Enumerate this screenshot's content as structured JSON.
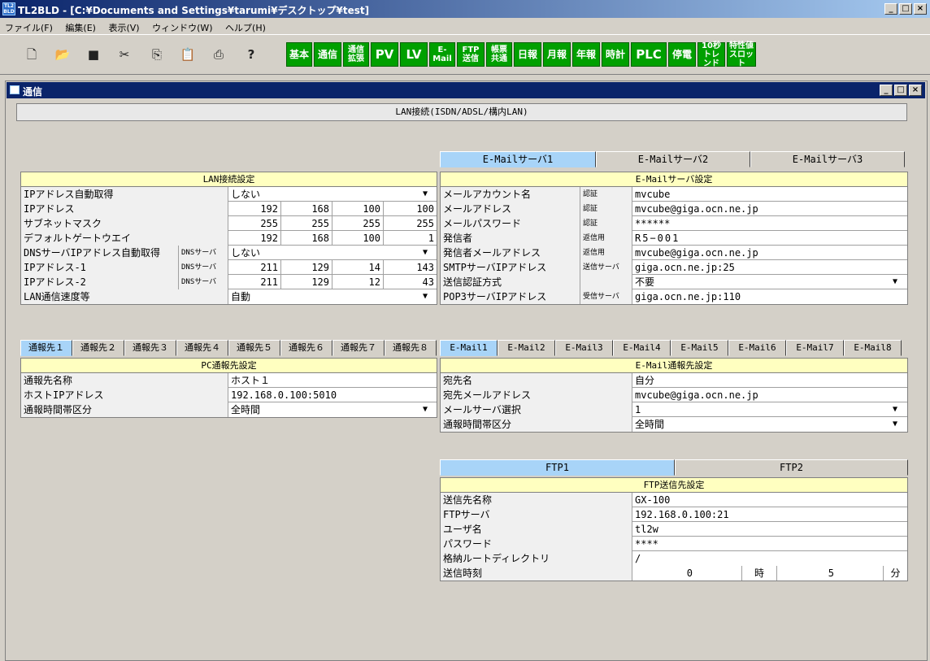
{
  "window": {
    "title": "TL2BLD - [C:¥Documents and Settings¥tarumi¥デスクトップ¥test]",
    "app_icon_text": "TL2 BLD",
    "min": "_",
    "max": "□",
    "close": "×"
  },
  "menu": [
    "ファイル(F)",
    "編集(E)",
    "表示(V)",
    "ウィンドウ(W)",
    "ヘルプ(H)"
  ],
  "toolbar": {
    "icons": [
      {
        "name": "new-file-icon",
        "glyph": "🗋"
      },
      {
        "name": "open-folder-icon",
        "glyph": "📂"
      },
      {
        "name": "save-icon",
        "glyph": "■"
      },
      {
        "name": "cut-icon",
        "glyph": "✂"
      },
      {
        "name": "copy-icon",
        "glyph": "⎘"
      },
      {
        "name": "paste-icon",
        "glyph": "📋"
      },
      {
        "name": "print-icon",
        "glyph": "⎙"
      },
      {
        "name": "help-icon",
        "glyph": "?"
      }
    ],
    "buttons": [
      "基本",
      "通信",
      "通信 拡張",
      "PV",
      "LV",
      "E- Mail",
      "FTP 送信",
      "帳票 共通",
      "日報",
      "月報",
      "年報",
      "時計",
      "PLC",
      "停電",
      "10秒 トレンド",
      "特性値 スロット"
    ],
    "accent": "#00a000"
  },
  "child": {
    "title": "通信",
    "min": "_",
    "max": "□",
    "close": "×"
  },
  "banner": "LAN接続(ISDN/ADSL/構内LAN)",
  "lan": {
    "header": "LAN接続設定",
    "rows": [
      {
        "label": "IPアドレス自動取得",
        "sub": "",
        "value": "しない",
        "dd": true
      },
      {
        "label": "IPアドレス",
        "sub": "",
        "ip": [
          "192",
          "168",
          "100",
          "100"
        ]
      },
      {
        "label": "サブネットマスク",
        "sub": "",
        "ip": [
          "255",
          "255",
          "255",
          "255"
        ]
      },
      {
        "label": "デフォルトゲートウエイ",
        "sub": "",
        "ip": [
          "192",
          "168",
          "100",
          "1"
        ]
      },
      {
        "label": "DNSサーバIPアドレス自動取得",
        "sub": "DNSサーバ",
        "value": "しない",
        "dd": true
      },
      {
        "label": "IPアドレス-1",
        "sub": "DNSサーバ",
        "ip": [
          "211",
          "129",
          "14",
          "143"
        ]
      },
      {
        "label": "IPアドレス-2",
        "sub": "DNSサーバ",
        "ip": [
          "211",
          "129",
          "12",
          "43"
        ]
      },
      {
        "label": "LAN通信速度等",
        "sub": "",
        "value": "自動",
        "dd": true
      }
    ]
  },
  "mailserver": {
    "tabs": [
      "E-Mailサーバ1",
      "E-Mailサーバ2",
      "E-Mailサーバ3"
    ],
    "header": "E-Mailサーバ設定",
    "rows": [
      {
        "label": "メールアカウント名",
        "sub": "認証",
        "value": "mvcube"
      },
      {
        "label": "メールアドレス",
        "sub": "認証",
        "value": "mvcube@giga.ocn.ne.jp"
      },
      {
        "label": "メールパスワード",
        "sub": "認証",
        "value": "******"
      },
      {
        "label": "発信者",
        "sub": "返信用",
        "value": "R5−001"
      },
      {
        "label": "発信者メールアドレス",
        "sub": "返信用",
        "value": "mvcube@giga.ocn.ne.jp"
      },
      {
        "label": "SMTPサーバIPアドレス",
        "sub": "送信サーバ",
        "value": "giga.ocn.ne.jp:25"
      },
      {
        "label": "送信認証方式",
        "sub": "",
        "value": "不要",
        "dd": true
      },
      {
        "label": "POP3サーバIPアドレス",
        "sub": "受信サーバ",
        "value": "giga.ocn.ne.jp:110"
      }
    ]
  },
  "pc": {
    "tabs": [
      "通報先１",
      "通報先２",
      "通報先３",
      "通報先４",
      "通報先５",
      "通報先６",
      "通報先７",
      "通報先８"
    ],
    "header": "PC通報先設定",
    "rows": [
      {
        "label": "通報先名称",
        "value": "ホスト１"
      },
      {
        "label": "ホストIPアドレス",
        "value": "192.168.0.100:5010"
      },
      {
        "label": "通報時間帯区分",
        "value": "全時間",
        "dd": true
      }
    ]
  },
  "email": {
    "tabs": [
      "E-Mail1",
      "E-Mail2",
      "E-Mail3",
      "E-Mail4",
      "E-Mail5",
      "E-Mail6",
      "E-Mail7",
      "E-Mail8"
    ],
    "header": "E-Mail通報先設定",
    "rows": [
      {
        "label": "宛先名",
        "value": "自分"
      },
      {
        "label": "宛先メールアドレス",
        "value": "mvcube@giga.ocn.ne.jp"
      },
      {
        "label": "メールサーバ選択",
        "value": "1",
        "dd": true
      },
      {
        "label": "通報時間帯区分",
        "value": "全時間",
        "dd": true
      }
    ]
  },
  "ftp": {
    "tabs": [
      "FTP1",
      "FTP2"
    ],
    "header": "FTP送信先設定",
    "rows": [
      {
        "label": "送信先名称",
        "value": "GX-100"
      },
      {
        "label": "FTPサーバ",
        "value": "192.168.0.100:21"
      },
      {
        "label": "ユーザ名",
        "value": "tl2w"
      },
      {
        "label": "パスワード",
        "value": "****"
      },
      {
        "label": "格納ルートディレクトリ",
        "value": "/"
      }
    ],
    "time": {
      "label": "送信時刻",
      "hour": "0",
      "hour_unit": "時",
      "min": "5",
      "min_unit": "分"
    }
  },
  "dropdown_glyph": "▼"
}
